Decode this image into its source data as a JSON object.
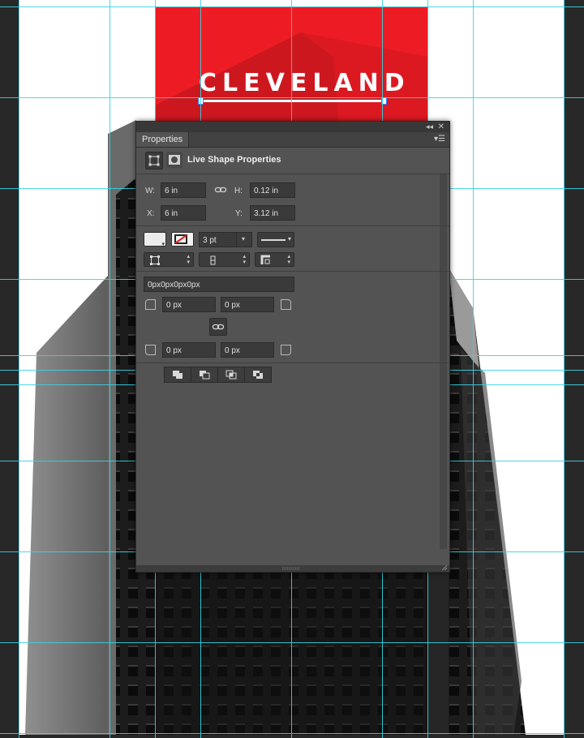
{
  "document": {
    "logo_text": "CLEVELAND",
    "colors": {
      "accent_red": "#ed1c24",
      "guide": "#39d4e4",
      "artboard": "#ffffff",
      "pasteboard": "#282828"
    }
  },
  "panel": {
    "tab": "Properties",
    "collapse_icon": "double-chevron-left-icon",
    "close_icon": "close-icon",
    "menu_icon": "panel-menu-icon",
    "header_title": "Live Shape Properties",
    "w_label": "W:",
    "w_value": "6 in",
    "h_label": "H:",
    "h_value": "0.12 in",
    "x_label": "X:",
    "x_value": "6 in",
    "y_label": "Y:",
    "y_value": "3.12 in",
    "stroke_width": "3 pt",
    "corner_radius_combined": "0px0px0px0px",
    "corner_tl": "0 px",
    "corner_tr": "0 px",
    "corner_bl": "0 px",
    "corner_br": "0 px"
  }
}
